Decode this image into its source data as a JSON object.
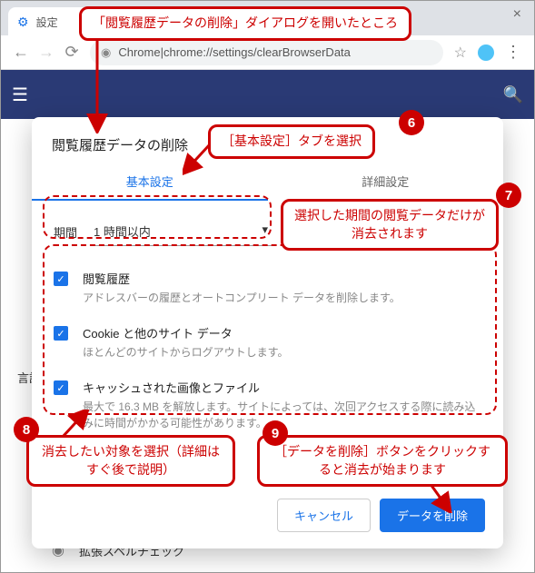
{
  "annotations": {
    "top_callout": "「閲覧履歴データの削除」ダイアログを開いたところ",
    "callout6": "［基本設定］タブを選択",
    "callout7": "選択した期間の閲覧データだけが消去されます",
    "callout8": "消去したい対象を選択（詳細はすぐ後で説明）",
    "callout9": "［データを削除］ボタンをクリックすると消去が始まります",
    "badge6": "6",
    "badge7": "7",
    "badge8": "8",
    "badge9": "9"
  },
  "browser": {
    "tab_title": "設定",
    "address_prefix": "Chrome",
    "address_sep": " | ",
    "address_url": "chrome://settings/clearBrowserData"
  },
  "bg": {
    "lang_heading": "言語",
    "spell_item": "拡張スペルチェック"
  },
  "dialog": {
    "title": "閲覧履歴データの削除",
    "tab_basic": "基本設定",
    "tab_advanced": "詳細設定",
    "period_label": "期間",
    "period_value": "1 時間以内",
    "items": [
      {
        "title": "閲覧履歴",
        "desc": "アドレスバーの履歴とオートコンプリート データを削除します。"
      },
      {
        "title": "Cookie と他のサイト データ",
        "desc": "ほとんどのサイトからログアウトします。"
      },
      {
        "title": "キャッシュされた画像とファイル",
        "desc": "最大で 16.3 MB を解放します。サイトによっては、次回アクセスする際に読み込みに時間がかかる可能性があります。"
      }
    ],
    "cancel": "キャンセル",
    "confirm": "データを削除"
  }
}
